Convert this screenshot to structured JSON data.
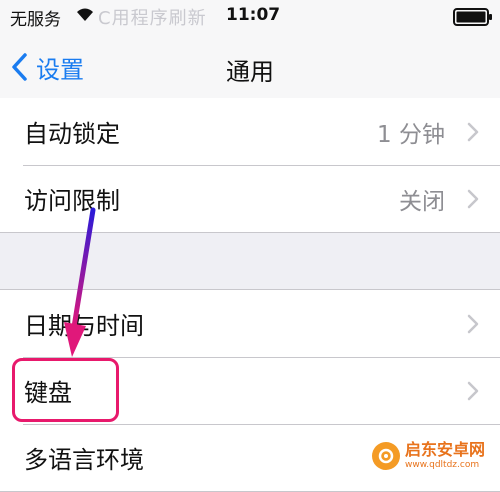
{
  "status_bar": {
    "carrier": "无服务",
    "faded_text": "C用程序刷新",
    "time": "11:07"
  },
  "nav": {
    "back_label": "设置",
    "title": "通用",
    "accent_color": "#1a7cf0"
  },
  "group1": [
    {
      "label": "自动锁定",
      "value": "1 分钟"
    },
    {
      "label": "访问限制",
      "value": "关闭"
    }
  ],
  "group2": [
    {
      "label": "日期与时间",
      "value": ""
    },
    {
      "label": "键盘",
      "value": ""
    },
    {
      "label": "多语言环境",
      "value": ""
    }
  ],
  "annotation": {
    "highlight_color": "#e8196c",
    "arrow_color": "blue-to-magenta gradient"
  },
  "watermark": {
    "name": "启东安卓网",
    "url": "www.qdltdz.com"
  }
}
